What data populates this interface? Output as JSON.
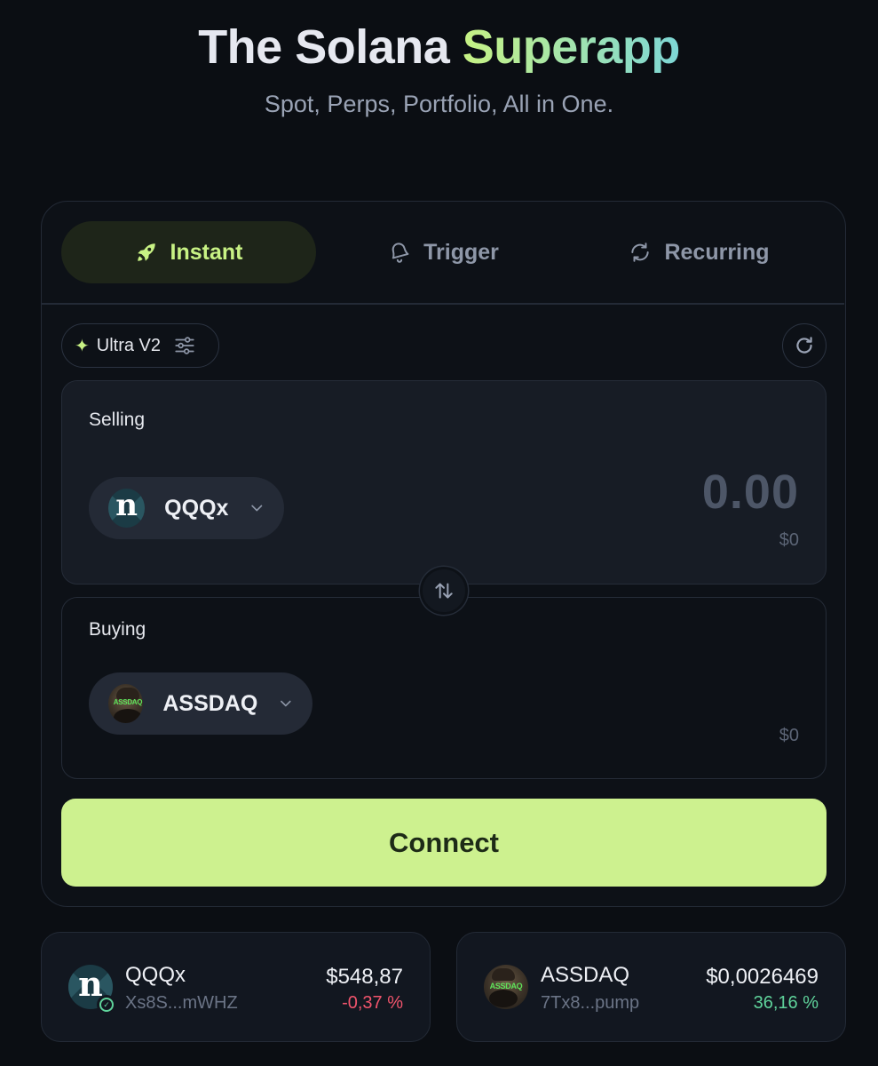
{
  "hero": {
    "title_main": "The Solana",
    "title_accent": "Superapp",
    "subtitle": "Spot, Perps, Portfolio, All in One."
  },
  "tabs": [
    {
      "label": "Instant",
      "icon": "rocket-icon",
      "active": true
    },
    {
      "label": "Trigger",
      "icon": "bell-icon",
      "active": false
    },
    {
      "label": "Recurring",
      "icon": "recurring-icon",
      "active": false
    }
  ],
  "router": {
    "label": "Ultra V2",
    "icon": "sparkle-icon",
    "settings_icon": "sliders-icon"
  },
  "refresh_icon": "refresh-icon",
  "selling": {
    "label": "Selling",
    "token": "QQQx",
    "amount": "0.00",
    "usd": "$0"
  },
  "buying": {
    "label": "Buying",
    "token": "ASSDAQ",
    "usd": "$0"
  },
  "swap_icon": "swap-arrows-icon",
  "connect_label": "Connect",
  "token_cards": [
    {
      "name": "QQQx",
      "address": "Xs8S...mWHZ",
      "price": "$548,87",
      "change": "-0,37 %",
      "direction": "down"
    },
    {
      "name": "ASSDAQ",
      "address": "7Tx8...pump",
      "price": "$0,0026469",
      "change": "36,16 %",
      "direction": "up"
    }
  ],
  "logo_text": {
    "qqqx": "n",
    "assdaq": "ASSDAQ"
  },
  "colors": {
    "background": "#0b0e13",
    "accent": "#c8f284",
    "connect_bg": "#cdf18f",
    "negative": "#f0546c",
    "positive": "#5fd39b"
  }
}
